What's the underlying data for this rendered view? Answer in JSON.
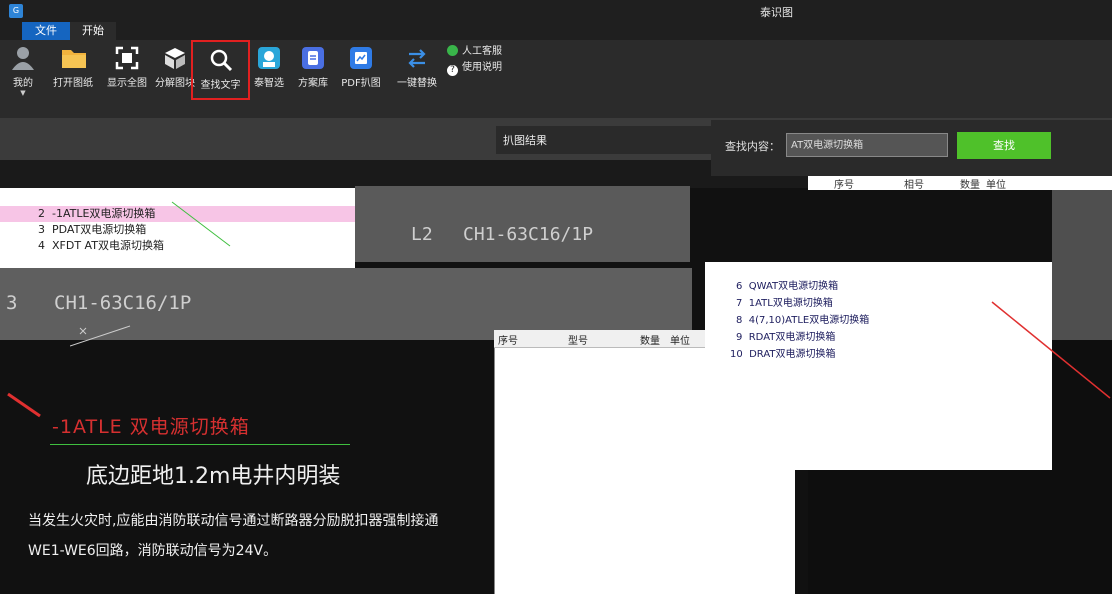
{
  "window": {
    "title": "泰识图",
    "app_icon": "G"
  },
  "menu": {
    "tabs": [
      "文件",
      "开始"
    ]
  },
  "ribbon": {
    "buttons": [
      {
        "label": "我的",
        "icon": "user-icon"
      },
      {
        "label": "打开图纸",
        "icon": "folder-icon"
      },
      {
        "label": "显示全图",
        "icon": "fullscreen-icon"
      },
      {
        "label": "分解图块",
        "icon": "cube-icon"
      },
      {
        "label": "查找文字",
        "icon": "search-icon"
      },
      {
        "label": "泰智选",
        "icon": "robot-icon"
      },
      {
        "label": "方案库",
        "icon": "library-icon"
      },
      {
        "label": "PDF扒图",
        "icon": "pdf-icon"
      },
      {
        "label": "一键替换",
        "icon": "swap-icon"
      }
    ],
    "small": [
      {
        "label": "人工客服",
        "icon": "chat-icon",
        "color": "#39b54a"
      },
      {
        "label": "使用说明",
        "icon": "help-icon",
        "color": "#ffffff"
      }
    ]
  },
  "popup": {
    "title": "扒图结果",
    "search_label": "查找内容：",
    "search_value": "AT双电源切换箱",
    "search_button": "查找"
  },
  "result_header": {
    "cols": [
      "序号",
      "相号",
      "数量",
      "单位"
    ]
  },
  "table_header": {
    "cols": [
      "序号",
      "型号",
      "数量",
      "单位"
    ]
  },
  "left_list": [
    {
      "num": "2",
      "text": "-1ATLE双电源切换箱",
      "selected": true
    },
    {
      "num": "3",
      "text": "PDAT双电源切换箱",
      "selected": false
    },
    {
      "num": "4",
      "text": "XFDT AT双电源切换箱",
      "selected": false
    }
  ],
  "right_list": [
    {
      "num": "6",
      "text": "QWAT双电源切换箱"
    },
    {
      "num": "7",
      "text": "1ATL双电源切换箱"
    },
    {
      "num": "8",
      "text": "4(7,10)ATLE双电源切换箱"
    },
    {
      "num": "9",
      "text": "RDAT双电源切换箱"
    },
    {
      "num": "10",
      "text": "DRAT双电源切换箱"
    }
  ],
  "cad": {
    "l2": "L2",
    "breaker_1": "CH1-63C16/1P",
    "l3": "3",
    "breaker_2": "CH1-63C16/1P",
    "red_title": "-1ATLE 双电源切换箱",
    "main_note": "底边距地1.2m电井内明装",
    "fire_line_1": "当发生火灾时,应能由消防联动信号通过断路器分励脱扣器强制接通",
    "fire_line_2": "WE1-WE6回路，消防联动信号为24V。"
  },
  "colors": {
    "accent": "#1565c0",
    "search_button": "#4fc12a",
    "highlight": "#e12020",
    "selected_row": "#f7c5e6"
  }
}
